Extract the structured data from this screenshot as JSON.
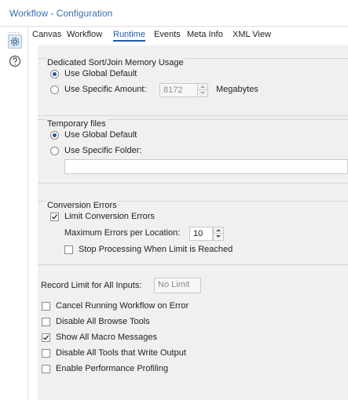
{
  "window": {
    "title": "Workflow - Configuration"
  },
  "leftbar": {
    "dots": "....",
    "icons": [
      "gear-icon",
      "help-icon"
    ]
  },
  "tabs": [
    {
      "label": "Canvas",
      "active": false
    },
    {
      "label": "Workflow",
      "active": false
    },
    {
      "label": "Runtime",
      "active": true
    },
    {
      "label": "Events",
      "active": false
    },
    {
      "label": "Meta Info",
      "active": false
    },
    {
      "label": "XML View",
      "active": false
    }
  ],
  "memory": {
    "title": "Dedicated Sort/Join Memory Usage",
    "option_global": "Use Global Default",
    "option_specific": "Use Specific Amount:",
    "amount": "8172",
    "unit": "Megabytes",
    "selected": "global"
  },
  "temp": {
    "title": "Temporary files",
    "option_global": "Use Global Default",
    "option_specific": "Use Specific Folder:",
    "folder": "",
    "selected": "global"
  },
  "conversion": {
    "title": "Conversion Errors",
    "limit_label": "Limit Conversion Errors",
    "limit_checked": true,
    "max_label": "Maximum Errors per Location:",
    "max_value": "10",
    "stop_label": "Stop Processing When Limit is Reached",
    "stop_checked": false
  },
  "record_limit": {
    "label": "Record Limit for All Inputs:",
    "placeholder": "No Limit"
  },
  "options": [
    {
      "label": "Cancel Running Workflow on Error",
      "checked": false
    },
    {
      "label": "Disable All Browse Tools",
      "checked": false
    },
    {
      "label": "Show All Macro Messages",
      "checked": true
    },
    {
      "label": "Disable All Tools that Write Output",
      "checked": false
    },
    {
      "label": "Enable Performance Profiling",
      "checked": false
    }
  ],
  "colors": {
    "accent": "#1f5aa6",
    "title": "#3a6fb0",
    "panel": "#f0f0f0"
  }
}
